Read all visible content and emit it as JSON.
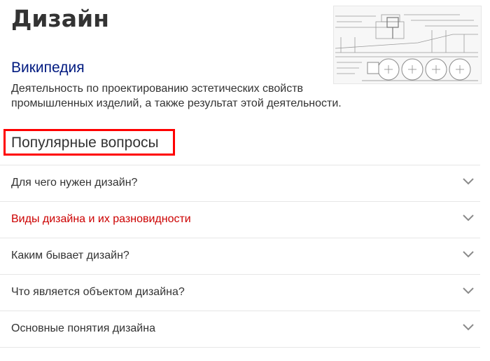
{
  "entity": {
    "title": "Дизайн",
    "source_label": "Википедия",
    "description": "Деятельность по проектированию эстетических свойств промышленных изделий, а также результат этой деятельности."
  },
  "popular_questions": {
    "heading": "Популярные вопросы",
    "items": [
      {
        "question": "Для чего нужен дизайн?"
      },
      {
        "question": "Виды дизайна и их разновидности"
      },
      {
        "question": "Каким бывает дизайн?"
      },
      {
        "question": "Что является объектом дизайна?"
      },
      {
        "question": "Основные понятия дизайна"
      }
    ]
  },
  "icons": {
    "expand": "chevron-down-icon"
  },
  "colors": {
    "title": "#333333",
    "source_link": "#001a80",
    "active_question": "#cc0000",
    "highlight_box": "#ff0000",
    "chevron": "#8a8a8a"
  }
}
